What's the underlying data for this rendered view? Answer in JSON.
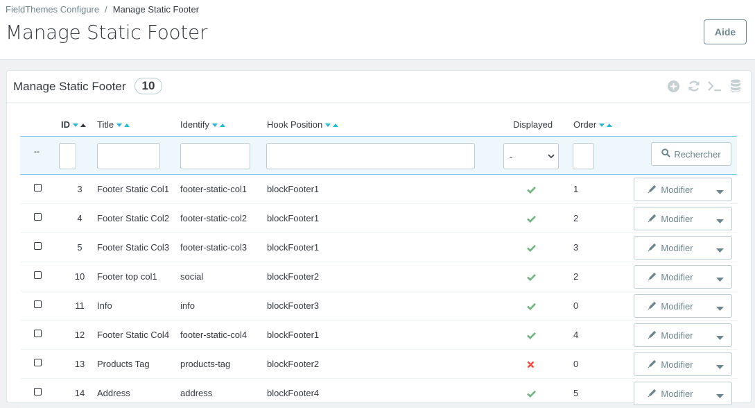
{
  "breadcrumb": {
    "parent": "FieldThemes Configure",
    "separator": "/",
    "current": "Manage Static Footer"
  },
  "page_title": "Manage Static Footer",
  "help_label": "Aide",
  "panel": {
    "title": "Manage Static Footer",
    "count": "10"
  },
  "toolbar_icons": [
    "add-icon",
    "refresh-icon",
    "sql-icon",
    "database-icon"
  ],
  "columns": {
    "id": "ID",
    "title": "Title",
    "identify": "Identify",
    "hook": "Hook Position",
    "displayed": "Displayed",
    "order": "Order"
  },
  "filters": {
    "bulk_placeholder": "--",
    "displayed_value": "-",
    "search_label": "Rechercher"
  },
  "rows": [
    {
      "id": "3",
      "title": "Footer Static Col1",
      "identify": "footer-static-col1",
      "hook": "blockFooter1",
      "displayed": true,
      "order": "1"
    },
    {
      "id": "4",
      "title": "Footer Static Col2",
      "identify": "footer-static-col2",
      "hook": "blockFooter1",
      "displayed": true,
      "order": "2"
    },
    {
      "id": "5",
      "title": "Footer Static Col3",
      "identify": "footer-static-col3",
      "hook": "blockFooter1",
      "displayed": true,
      "order": "3"
    },
    {
      "id": "10",
      "title": "Footer top col1",
      "identify": "social",
      "hook": "blockFooter2",
      "displayed": true,
      "order": "2"
    },
    {
      "id": "11",
      "title": "Info",
      "identify": "info",
      "hook": "blockFooter3",
      "displayed": true,
      "order": "0"
    },
    {
      "id": "12",
      "title": "Footer Static Col4",
      "identify": "footer-static-col4",
      "hook": "blockFooter1",
      "displayed": true,
      "order": "4"
    },
    {
      "id": "13",
      "title": "Products Tag",
      "identify": "products-tag",
      "hook": "blockFooter2",
      "displayed": false,
      "order": "0"
    },
    {
      "id": "14",
      "title": "Address",
      "identify": "address",
      "hook": "blockFooter4",
      "displayed": true,
      "order": "5"
    }
  ],
  "row_action_label": "Modifier",
  "colors": {
    "accent": "#25b9d7",
    "check": "#70b580",
    "cross": "#f54c3e"
  }
}
